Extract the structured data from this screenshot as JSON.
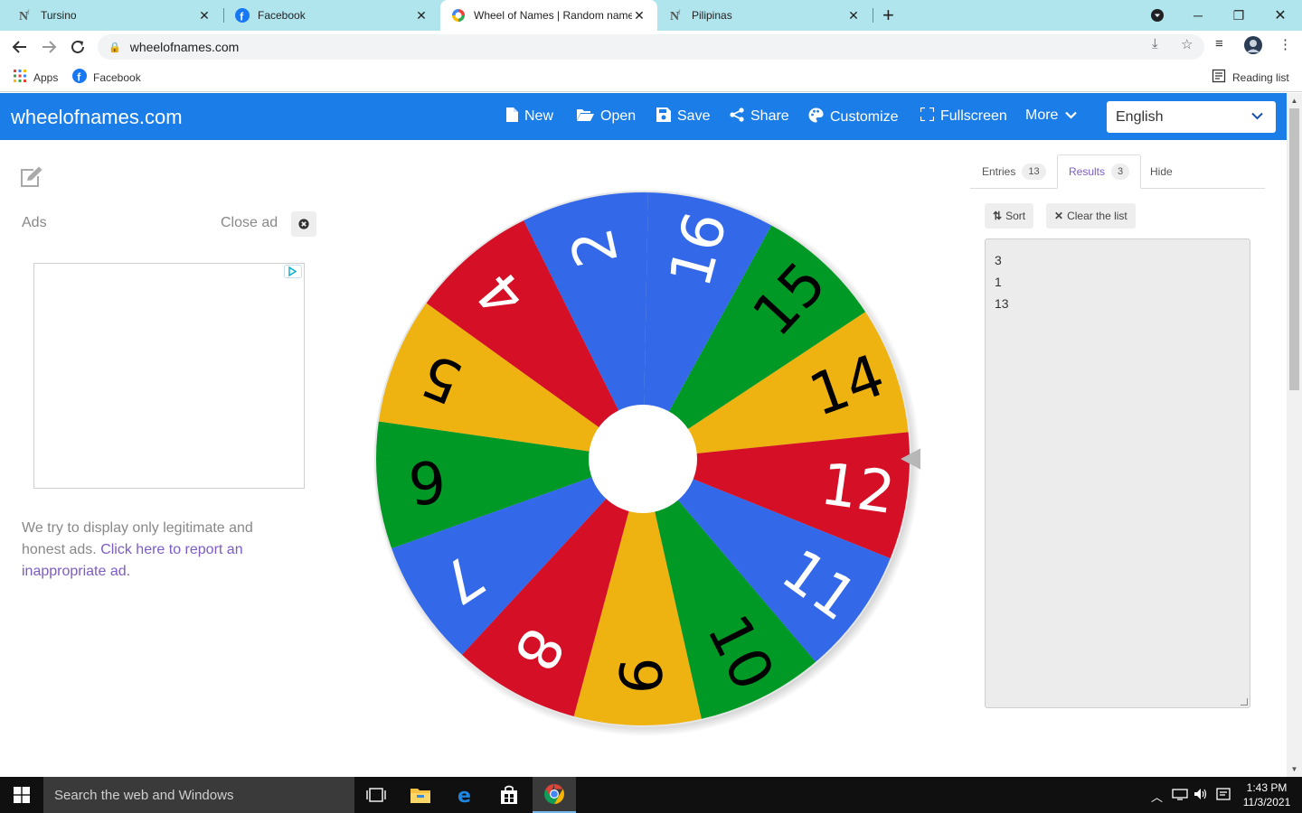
{
  "browser": {
    "tabs": [
      {
        "title": "Tursino",
        "favicon": "notion-icon",
        "active": false
      },
      {
        "title": "Facebook",
        "favicon": "facebook-icon",
        "active": false
      },
      {
        "title": "Wheel of Names | Random name picker",
        "favicon": "google-icon",
        "active": true
      },
      {
        "title": "Pilipinas",
        "favicon": "notion-icon",
        "active": false
      }
    ],
    "url": "wheelofnames.com",
    "bookmarks": [
      {
        "label": "Apps",
        "icon": "apps-grid-icon"
      },
      {
        "label": "Facebook",
        "icon": "facebook-icon"
      }
    ],
    "reading_list_label": "Reading list",
    "colors": {
      "tabbar": "#b1e5ee",
      "omnibox": "#f1f3f4"
    }
  },
  "site": {
    "logo": "wheelofnames.com",
    "menu": [
      {
        "label": "New",
        "icon": "file-icon"
      },
      {
        "label": "Open",
        "icon": "folder-open-icon"
      },
      {
        "label": "Save",
        "icon": "floppy-icon"
      },
      {
        "label": "Share",
        "icon": "share-icon"
      },
      {
        "label": "Customize",
        "icon": "palette-icon"
      },
      {
        "label": "Fullscreen",
        "icon": "expand-icon"
      },
      {
        "label": "More",
        "icon": "chevron-down-icon"
      }
    ],
    "language": "English",
    "colors": {
      "header": "#1a7de8",
      "link": "#7c5cc4"
    }
  },
  "ads": {
    "label": "Ads",
    "close_label": "Close ad",
    "note_text": "We try to display only legitimate and honest ads.",
    "note_link": "Click here to report an inappropriate ad."
  },
  "wheel": {
    "segments": [
      {
        "label": "16",
        "color": "#3369e8"
      },
      {
        "label": "15",
        "color": "#009925"
      },
      {
        "label": "14",
        "color": "#eeb211"
      },
      {
        "label": "12",
        "color": "#d50f25"
      },
      {
        "label": "11",
        "color": "#3369e8"
      },
      {
        "label": "10",
        "color": "#009925"
      },
      {
        "label": "9",
        "color": "#eeb211"
      },
      {
        "label": "8",
        "color": "#d50f25"
      },
      {
        "label": "7",
        "color": "#3369e8"
      },
      {
        "label": "6",
        "color": "#009925"
      },
      {
        "label": "5",
        "color": "#eeb211"
      },
      {
        "label": "4",
        "color": "#d50f25"
      },
      {
        "label": "2",
        "color": "#3369e8"
      }
    ],
    "first_segment_label_angle_deg": 15,
    "label_colors": {
      "#3369e8": "#ffffff",
      "#d50f25": "#ffffff",
      "#009925": "#000000",
      "#eeb211": "#000000"
    }
  },
  "results": {
    "tabs": [
      {
        "label": "Entries",
        "count": "13"
      },
      {
        "label": "Results",
        "count": "3"
      },
      {
        "label": "Hide"
      }
    ],
    "sort_label": "Sort",
    "clear_label": "Clear the list",
    "items": [
      "3",
      "1",
      "13"
    ]
  },
  "taskbar": {
    "search_placeholder": "Search the web and Windows",
    "time": "1:43 PM",
    "date": "11/3/2021"
  }
}
